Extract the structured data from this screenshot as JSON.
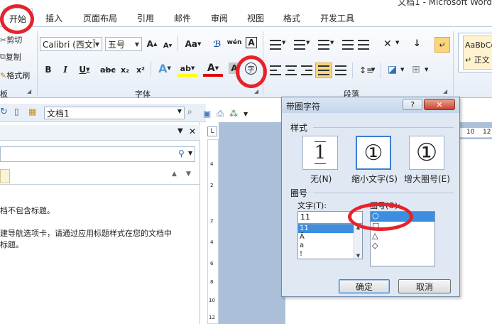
{
  "window": {
    "title": "文档1 - Microsoft Word"
  },
  "tabs": [
    "开始",
    "插入",
    "页面布局",
    "引用",
    "邮件",
    "审阅",
    "视图",
    "格式",
    "开发工具"
  ],
  "clipboard": {
    "cut": "剪切",
    "copy": "复制",
    "format_painter": "格式刷",
    "group_label": "板"
  },
  "font": {
    "name": "Calibri (西文Ī",
    "size": "五号",
    "group_label": "字体",
    "grow": "A",
    "shrink": "A",
    "case": "Aa",
    "clear": "ℬ",
    "phonetic": "wén",
    "border_char": "A",
    "bold": "B",
    "italic": "I",
    "underline": "U",
    "strike": "abc",
    "subscript": "x₂",
    "superscript": "x²",
    "effects": "A",
    "highlight": "ab",
    "color": "A",
    "shading": "A",
    "enclose_char": "字"
  },
  "paragraph": {
    "group_label": "段落"
  },
  "styles": {
    "sample": "AaBbCc",
    "name": "↵ 正文"
  },
  "document_bar": {
    "name": "文档1"
  },
  "nav": {
    "line1": "档不包含标题。",
    "line2": "建导航选项卡，请通过应用标题样式在您的文档中",
    "line3": "标题。"
  },
  "ruler": {
    "marks": [
      "10",
      "12"
    ],
    "v_marks": [
      "4",
      "2",
      "2",
      "4",
      "6",
      "8",
      "10",
      "12"
    ]
  },
  "dialog": {
    "title": "带圈字符",
    "help": "?",
    "close": "✕",
    "style_section": "样式",
    "style_options": [
      {
        "label": "无(N)",
        "glyph": "1"
      },
      {
        "label": "缩小文字(S)",
        "glyph": "①"
      },
      {
        "label": "增大圈号(E)",
        "glyph": "①"
      }
    ],
    "enclosure_section": "圈号",
    "text_label": "文字(T):",
    "text_value": "11",
    "text_items": [
      "11",
      "Ā",
      "a",
      "!"
    ],
    "circle_label": "圈号(O):",
    "circle_items": [
      "○",
      "□",
      "△",
      "◇"
    ],
    "ok": "确定",
    "cancel": "取消"
  },
  "annotation": {
    "color": "#e8222a"
  }
}
